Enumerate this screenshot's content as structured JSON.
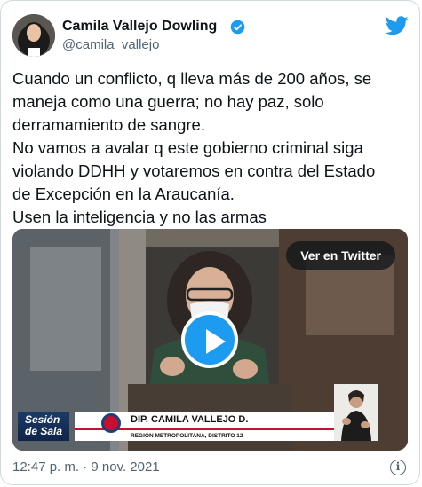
{
  "tweet": {
    "author_name": "Camila Vallejo Dowling",
    "handle": "@camila_vallejo",
    "text_lines": [
      "Cuando un conflicto, q lleva más de 200 años, se",
      "maneja como una guerra; no hay paz, solo",
      "derramamiento de sangre.",
      "No vamos a avalar q este gobierno criminal siga",
      "violando DDHH y votaremos en contra del Estado",
      "de Excepción en la Araucanía.",
      "Usen la inteligencia y no las armas"
    ],
    "timestamp": "12:47 p. m. · 9 nov. 2021"
  },
  "media": {
    "watch_button": "Ver en Twitter",
    "lower_third_show_line1": "Sesión",
    "lower_third_show_line2": "de Sala",
    "lower_third_name": "DIP.  CAMILA VALLEJO D.",
    "lower_third_region": "REGIÓN METROPOLITANA, DISTRITO 12"
  },
  "icons": {
    "verified": "verified-badge-icon",
    "brand": "twitter-bird-icon",
    "play": "play-icon",
    "info": "info-icon"
  },
  "colors": {
    "accent": "#1d9bf0",
    "text_primary": "#0f1419",
    "text_secondary": "#536471",
    "border": "#cfd9de"
  }
}
